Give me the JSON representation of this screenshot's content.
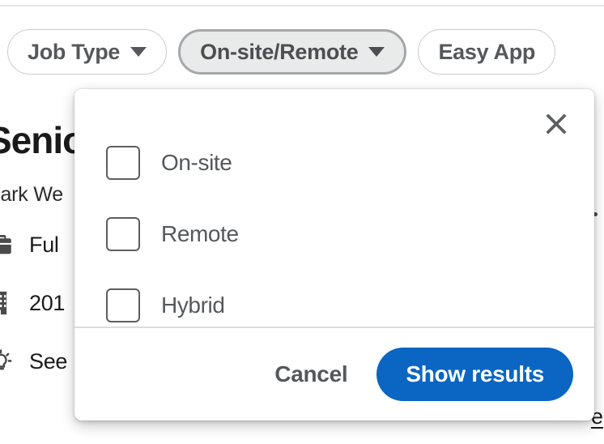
{
  "filter_bar": {
    "pills": [
      {
        "label": "Job Type",
        "icon": "chevron-down-icon",
        "active": false
      },
      {
        "label": "On-site/Remote",
        "icon": "chevron-down-icon",
        "active": true
      },
      {
        "label": "Easy App",
        "icon": "",
        "active": false
      }
    ]
  },
  "background_page": {
    "job_title": "Senio",
    "company": "Park We",
    "meta": [
      {
        "icon": "briefcase-icon",
        "text": "Ful"
      },
      {
        "icon": "building-icon",
        "text": "201"
      },
      {
        "icon": "lightbulb-icon",
        "text": "See"
      }
    ],
    "separator_dot": "·",
    "edge_link": "e"
  },
  "dropdown": {
    "close_icon": "close-icon",
    "options": [
      {
        "label": "On-site",
        "checked": false
      },
      {
        "label": "Remote",
        "checked": false
      },
      {
        "label": "Hybrid",
        "checked": false
      }
    ],
    "cancel_label": "Cancel",
    "submit_label": "Show results"
  },
  "colors": {
    "primary": "#0a66c2",
    "pill_active_bg": "#e9eaea",
    "pill_active_border": "#a5a8ab",
    "text_muted": "#56585b"
  }
}
